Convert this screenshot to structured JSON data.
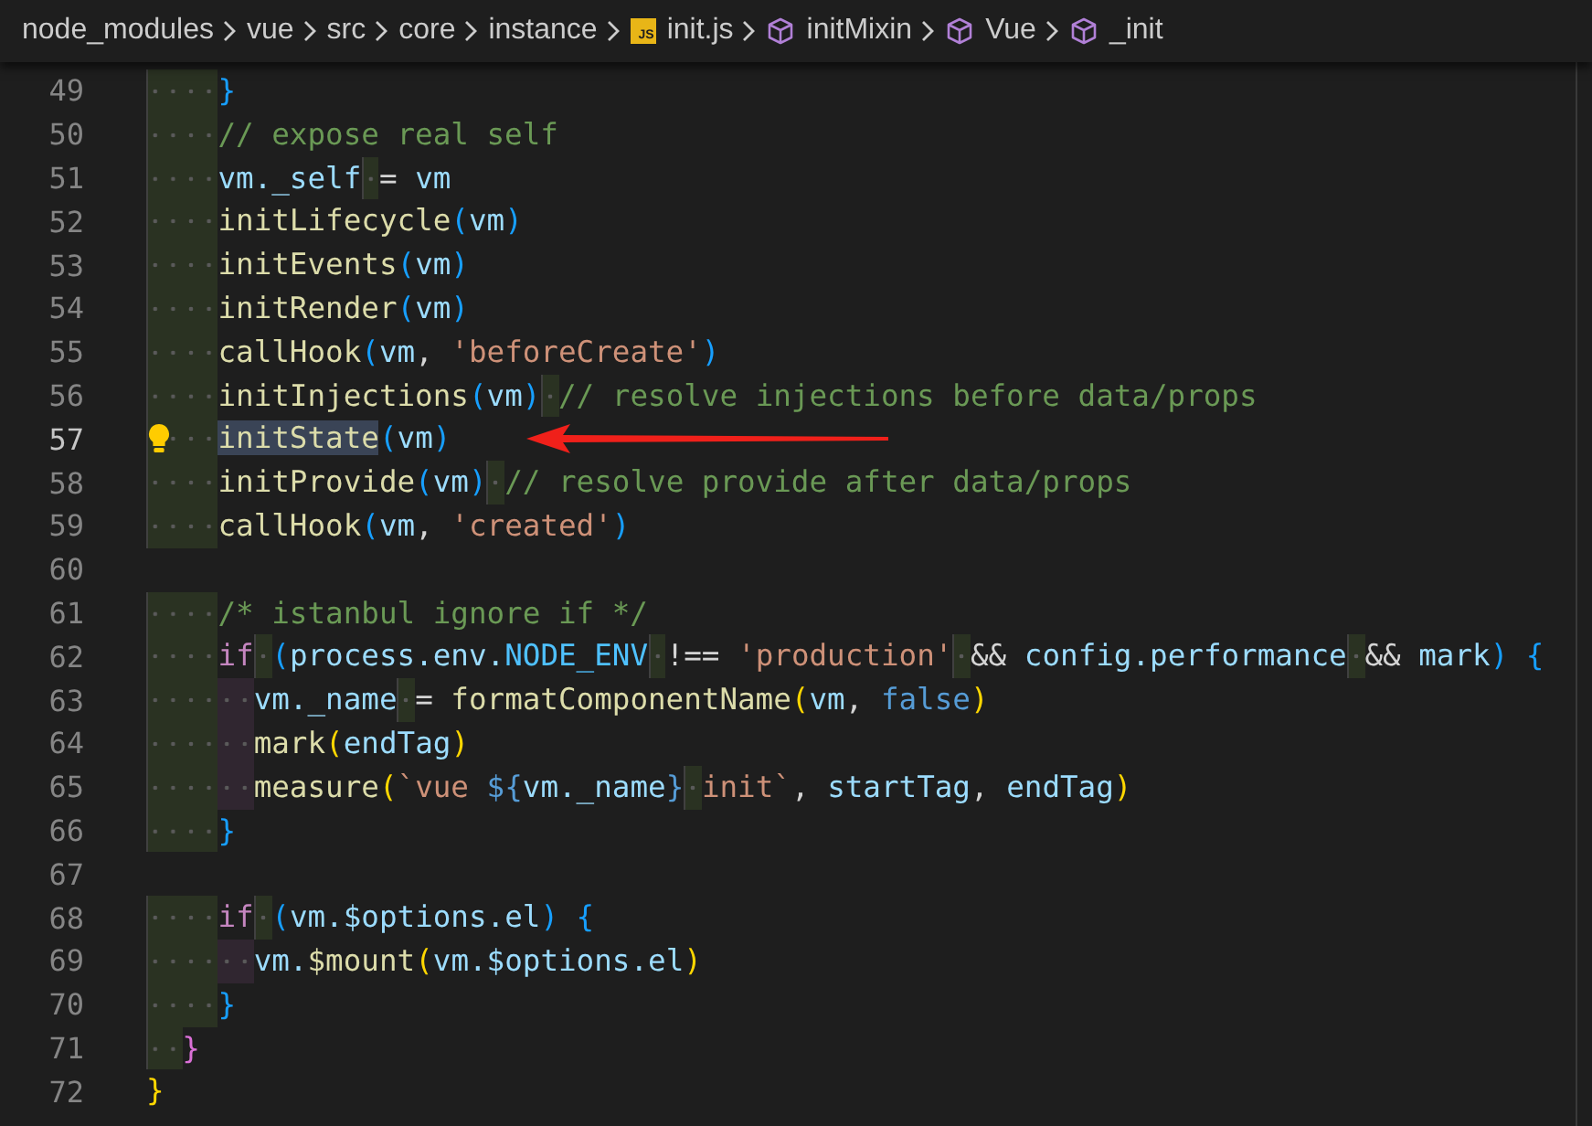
{
  "breadcrumb": [
    {
      "kind": "folder",
      "label": "node_modules"
    },
    {
      "kind": "folder",
      "label": "vue"
    },
    {
      "kind": "folder",
      "label": "src"
    },
    {
      "kind": "folder",
      "label": "core"
    },
    {
      "kind": "folder",
      "label": "instance"
    },
    {
      "kind": "file",
      "label": "init.js",
      "badge": "JS"
    },
    {
      "kind": "symbol",
      "label": "initMixin"
    },
    {
      "kind": "symbol",
      "label": "Vue"
    },
    {
      "kind": "symbol",
      "label": "_init"
    }
  ],
  "editor": {
    "lines": [
      {
        "number": "49",
        "current": false,
        "lightbulb": false,
        "tokens": [
          {
            "kind": "bracket3",
            "text": "    }"
          }
        ]
      },
      {
        "number": "50",
        "current": false,
        "lightbulb": false,
        "tokens": [
          {
            "kind": "comment",
            "text": "    // expose real self"
          }
        ]
      },
      {
        "number": "51",
        "current": false,
        "lightbulb": false,
        "tokens": [
          {
            "kind": "var",
            "text": "    vm._self"
          },
          {
            "kind": "punct",
            "text": " = "
          },
          {
            "kind": "var",
            "text": "vm"
          }
        ]
      },
      {
        "number": "52",
        "current": false,
        "lightbulb": false,
        "tokens": [
          {
            "kind": "fn",
            "text": "    initLifecycle"
          },
          {
            "kind": "bracket3",
            "text": "("
          },
          {
            "kind": "var",
            "text": "vm"
          },
          {
            "kind": "bracket3",
            "text": ")"
          }
        ]
      },
      {
        "number": "53",
        "current": false,
        "lightbulb": false,
        "tokens": [
          {
            "kind": "fn",
            "text": "    initEvents"
          },
          {
            "kind": "bracket3",
            "text": "("
          },
          {
            "kind": "var",
            "text": "vm"
          },
          {
            "kind": "bracket3",
            "text": ")"
          }
        ]
      },
      {
        "number": "54",
        "current": false,
        "lightbulb": false,
        "tokens": [
          {
            "kind": "fn",
            "text": "    initRender"
          },
          {
            "kind": "bracket3",
            "text": "("
          },
          {
            "kind": "var",
            "text": "vm"
          },
          {
            "kind": "bracket3",
            "text": ")"
          }
        ]
      },
      {
        "number": "55",
        "current": false,
        "lightbulb": false,
        "tokens": [
          {
            "kind": "fn",
            "text": "    callHook"
          },
          {
            "kind": "bracket3",
            "text": "("
          },
          {
            "kind": "var",
            "text": "vm"
          },
          {
            "kind": "punct",
            "text": ", "
          },
          {
            "kind": "string",
            "text": "'beforeCreate'"
          },
          {
            "kind": "bracket3",
            "text": ")"
          }
        ]
      },
      {
        "number": "56",
        "current": false,
        "lightbulb": false,
        "tokens": [
          {
            "kind": "fn",
            "text": "    initInjections"
          },
          {
            "kind": "bracket3",
            "text": "("
          },
          {
            "kind": "var",
            "text": "vm"
          },
          {
            "kind": "bracket3",
            "text": ")"
          },
          {
            "kind": "comment",
            "text": " // resolve injections before data/props"
          }
        ]
      },
      {
        "number": "57",
        "current": true,
        "lightbulb": true,
        "tokens": [
          {
            "kind": "selection",
            "text": "    initState"
          },
          {
            "kind": "bracket3",
            "text": "("
          },
          {
            "kind": "var",
            "text": "vm"
          },
          {
            "kind": "bracket3",
            "text": ")"
          }
        ]
      },
      {
        "number": "58",
        "current": false,
        "lightbulb": false,
        "tokens": [
          {
            "kind": "fn",
            "text": "    initProvide"
          },
          {
            "kind": "bracket3",
            "text": "("
          },
          {
            "kind": "var",
            "text": "vm"
          },
          {
            "kind": "bracket3",
            "text": ")"
          },
          {
            "kind": "comment",
            "text": " // resolve provide after data/props"
          }
        ]
      },
      {
        "number": "59",
        "current": false,
        "lightbulb": false,
        "tokens": [
          {
            "kind": "fn",
            "text": "    callHook"
          },
          {
            "kind": "bracket3",
            "text": "("
          },
          {
            "kind": "var",
            "text": "vm"
          },
          {
            "kind": "punct",
            "text": ", "
          },
          {
            "kind": "string",
            "text": "'created'"
          },
          {
            "kind": "bracket3",
            "text": ")"
          }
        ]
      },
      {
        "number": "60",
        "current": false,
        "lightbulb": false
      },
      {
        "number": "61",
        "current": false,
        "lightbulb": false,
        "tokens": [
          {
            "kind": "comment",
            "text": "    /* istanbul ignore if */"
          }
        ]
      },
      {
        "number": "62",
        "current": false,
        "lightbulb": false,
        "tokens": [
          {
            "kind": "keyword",
            "text": "    if"
          },
          {
            "kind": "bracket3",
            "text": " ("
          },
          {
            "kind": "var",
            "text": "process.env."
          },
          {
            "kind": "const",
            "text": "NODE_ENV"
          },
          {
            "kind": "punct",
            "text": " !== "
          },
          {
            "kind": "string",
            "text": "'production'"
          },
          {
            "kind": "punct",
            "text": " && "
          },
          {
            "kind": "var",
            "text": "config.performance"
          },
          {
            "kind": "punct",
            "text": " && "
          },
          {
            "kind": "var",
            "text": "mark"
          },
          {
            "kind": "bracket3",
            "text": ") {"
          }
        ]
      },
      {
        "number": "63",
        "current": false,
        "lightbulb": false,
        "tokens": [
          {
            "kind": "var",
            "text": "      vm._name"
          },
          {
            "kind": "punct",
            "text": " = "
          },
          {
            "kind": "fn",
            "text": "formatComponentName"
          },
          {
            "kind": "bracket1",
            "text": "("
          },
          {
            "kind": "var",
            "text": "vm"
          },
          {
            "kind": "punct",
            "text": ", "
          },
          {
            "kind": "boolean",
            "text": "false"
          },
          {
            "kind": "bracket1",
            "text": ")"
          }
        ]
      },
      {
        "number": "64",
        "current": false,
        "lightbulb": false,
        "tokens": [
          {
            "kind": "fn",
            "text": "      mark"
          },
          {
            "kind": "bracket1",
            "text": "("
          },
          {
            "kind": "var",
            "text": "endTag"
          },
          {
            "kind": "bracket1",
            "text": ")"
          }
        ]
      },
      {
        "number": "65",
        "current": false,
        "lightbulb": false,
        "tokens": [
          {
            "kind": "fn",
            "text": "      measure"
          },
          {
            "kind": "bracket1",
            "text": "("
          },
          {
            "kind": "string",
            "text": "`vue "
          },
          {
            "kind": "boolean",
            "text": "${"
          },
          {
            "kind": "var",
            "text": "vm._name"
          },
          {
            "kind": "boolean",
            "text": "}"
          },
          {
            "kind": "string",
            "text": " init`"
          },
          {
            "kind": "punct",
            "text": ", "
          },
          {
            "kind": "var",
            "text": "startTag"
          },
          {
            "kind": "punct",
            "text": ", "
          },
          {
            "kind": "var",
            "text": "endTag"
          },
          {
            "kind": "bracket1",
            "text": ")"
          }
        ]
      },
      {
        "number": "66",
        "current": false,
        "lightbulb": false,
        "tokens": [
          {
            "kind": "bracket3",
            "text": "    }"
          }
        ]
      },
      {
        "number": "67",
        "current": false,
        "lightbulb": false
      },
      {
        "number": "68",
        "current": false,
        "lightbulb": false,
        "tokens": [
          {
            "kind": "keyword",
            "text": "    if"
          },
          {
            "kind": "bracket3",
            "text": " ("
          },
          {
            "kind": "var",
            "text": "vm.$options.el"
          },
          {
            "kind": "bracket3",
            "text": ") {"
          }
        ]
      },
      {
        "number": "69",
        "current": false,
        "lightbulb": false,
        "tokens": [
          {
            "kind": "var",
            "text": "      vm."
          },
          {
            "kind": "fn",
            "text": "$mount"
          },
          {
            "kind": "bracket1",
            "text": "("
          },
          {
            "kind": "var",
            "text": "vm.$options.el"
          },
          {
            "kind": "bracket1",
            "text": ")"
          }
        ]
      },
      {
        "number": "70",
        "current": false,
        "lightbulb": false,
        "tokens": [
          {
            "kind": "bracket3",
            "text": "    }"
          }
        ]
      },
      {
        "number": "71",
        "current": false,
        "lightbulb": false,
        "tokens": [
          {
            "kind": "bracket2",
            "text": "  }"
          }
        ]
      },
      {
        "number": "72",
        "current": false,
        "lightbulb": false,
        "tokens": [
          {
            "kind": "bracket1",
            "text": "}"
          }
        ]
      }
    ]
  }
}
